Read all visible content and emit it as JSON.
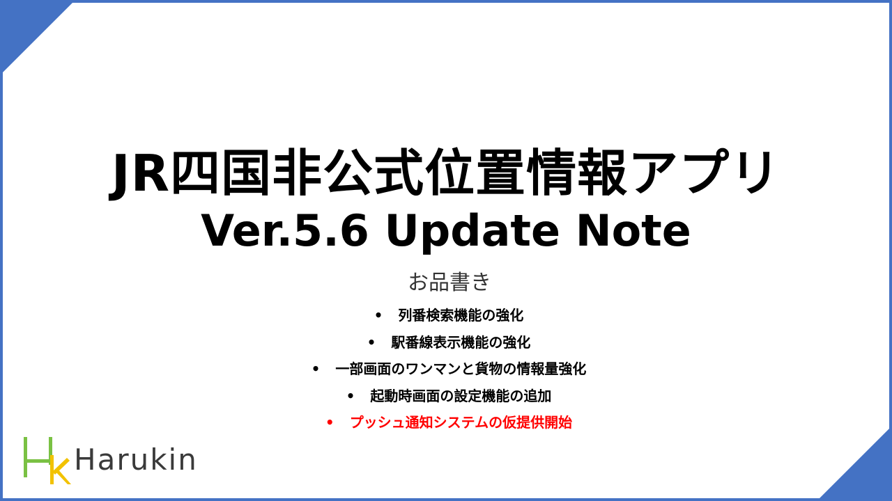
{
  "slide": {
    "title_line1": "JR四国非公式位置情報アプリ",
    "title_line2": "Ver.5.6 Update Note",
    "subtitle": "お品書き",
    "bullet_glyph": "•",
    "items": [
      {
        "text": "列番検索機能の強化",
        "highlight": false
      },
      {
        "text": "駅番線表示機能の強化",
        "highlight": false
      },
      {
        "text": "一部画面のワンマンと貨物の情報量強化",
        "highlight": false
      },
      {
        "text": "起動時画面の設定機能の追加",
        "highlight": false
      },
      {
        "text": "プッシュ通知システムの仮提供開始",
        "highlight": true
      }
    ]
  },
  "logo": {
    "text": "Harukin",
    "icon": "hk-logo-icon"
  },
  "colors": {
    "accent": "#4472c4",
    "highlight": "#ff0000",
    "logo_green": "#7ac143",
    "logo_yellow": "#f2c200"
  }
}
